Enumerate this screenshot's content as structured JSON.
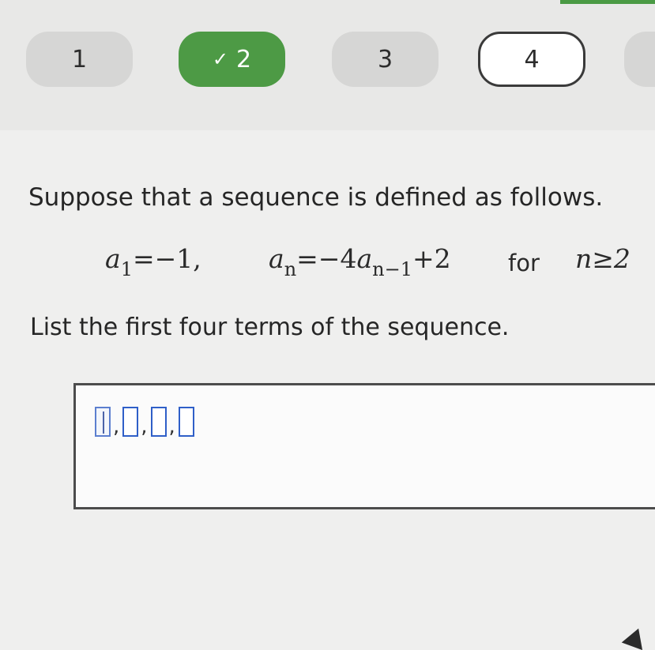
{
  "nav": {
    "items": [
      {
        "label": "1",
        "state": "default"
      },
      {
        "label": "2",
        "state": "completed",
        "icon": "check-icon"
      },
      {
        "label": "3",
        "state": "default"
      },
      {
        "label": "4",
        "state": "current"
      },
      {
        "label": "",
        "state": "default"
      }
    ]
  },
  "question": {
    "prompt": "Suppose that a sequence is defined as follows.",
    "formula": {
      "a1_var": "a",
      "a1_sub": "1",
      "a1_value": "=−1,",
      "an_var": "a",
      "an_sub": "n",
      "an_eq": "=−4",
      "an_prev_var": "a",
      "an_prev_sub": "n−1",
      "an_tail": "+2",
      "for_word": "for",
      "condition": "n≥2"
    },
    "instruction": "List the first four terms of the sequence."
  },
  "answer": {
    "slot_count": 4,
    "separator": ","
  },
  "colors": {
    "completed": "#4d9a45",
    "slot_border": "#2f5fc8",
    "background": "#efefee"
  }
}
